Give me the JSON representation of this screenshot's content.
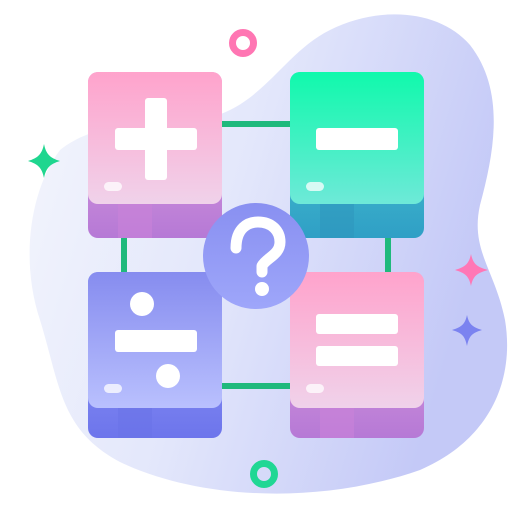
{
  "illustration": {
    "cards": [
      {
        "symbol": "plus",
        "icon": "plus-icon"
      },
      {
        "symbol": "minus",
        "icon": "minus-icon"
      },
      {
        "symbol": "divide",
        "icon": "divide-icon"
      },
      {
        "symbol": "equals",
        "icon": "equals-icon"
      }
    ],
    "center_badge": {
      "symbol": "question-mark",
      "icon": "question-mark-icon"
    },
    "colors": {
      "blob_light": "#eef1fb",
      "blob_dark": "#c6cbf8",
      "connector": "#1fb97c",
      "pink_top": "#ffa6cd",
      "pink_bottom": "#f2d0ea",
      "pink_base": "#c88fdc",
      "green_top": "#15f7b0",
      "green_bottom": "#5ee6d3",
      "green_base": "#3aa6c8",
      "blue_top": "#8b91ef",
      "blue_bottom": "#b5bdfd",
      "blue_base": "#7a82ee",
      "badge": "#8b93f2",
      "sparkle_green": "#20d794",
      "sparkle_pink": "#ff77b6",
      "sparkle_blue": "#7b83f0"
    }
  }
}
